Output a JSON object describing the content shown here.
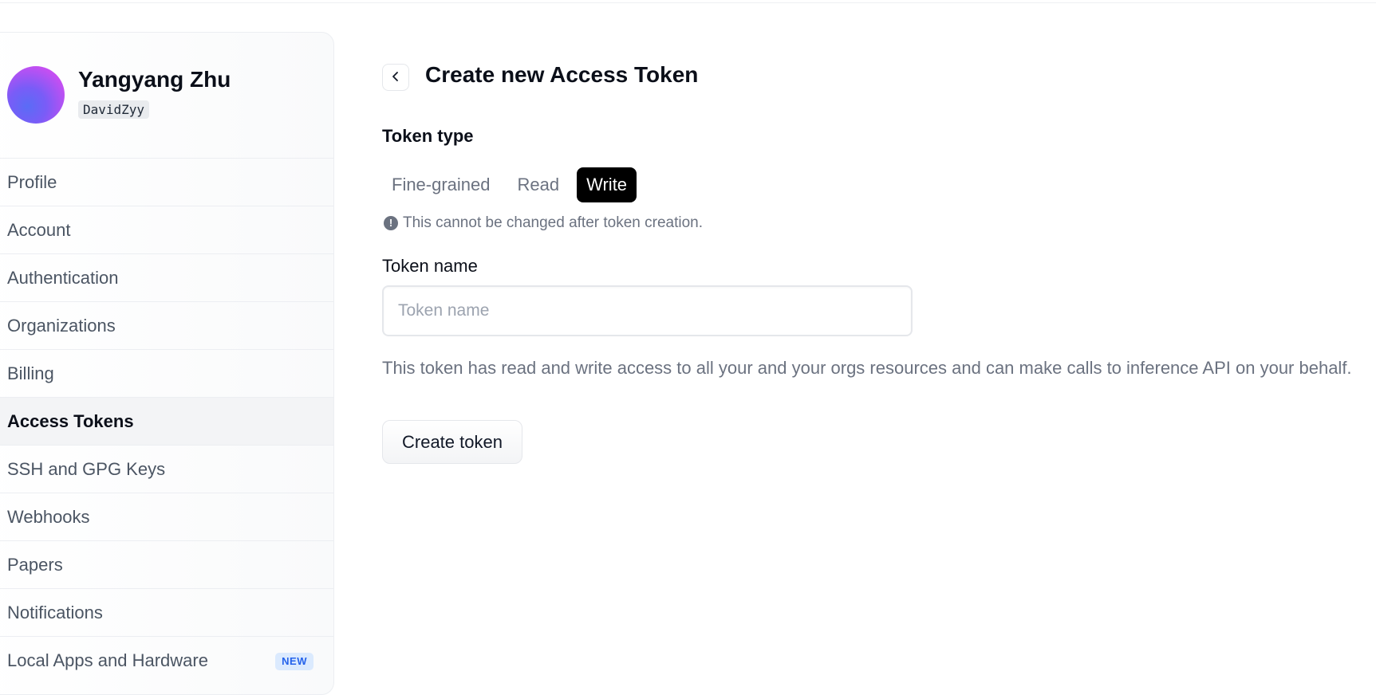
{
  "user": {
    "name": "Yangyang Zhu",
    "handle": "DavidZyy"
  },
  "sidebar": {
    "items": [
      {
        "label": "Profile"
      },
      {
        "label": "Account"
      },
      {
        "label": "Authentication"
      },
      {
        "label": "Organizations"
      },
      {
        "label": "Billing"
      },
      {
        "label": "Access Tokens",
        "active": true
      },
      {
        "label": "SSH and GPG Keys"
      },
      {
        "label": "Webhooks"
      },
      {
        "label": "Papers"
      },
      {
        "label": "Notifications"
      },
      {
        "label": "Local Apps and Hardware",
        "badge": "NEW"
      }
    ]
  },
  "main": {
    "back_icon": "chevron-left-icon",
    "title": "Create new Access Token",
    "token_type": {
      "label": "Token type",
      "options": [
        "Fine-grained",
        "Read",
        "Write"
      ],
      "selected": "Write",
      "warning_icon": "exclamation-circle-icon",
      "warning": "This cannot be changed after token creation."
    },
    "token_name": {
      "label": "Token name",
      "value": "",
      "placeholder": "Token name"
    },
    "description": "This token has read and write access to all your and your orgs resources and can make calls to inference API on your behalf.",
    "create_button": "Create token"
  },
  "colors": {
    "selected_segment_bg": "#000000",
    "badge_bg": "#dbeafe",
    "badge_text": "#2563eb",
    "avatar_gradient": [
      "#5a6cf6",
      "#c44ff2"
    ]
  }
}
